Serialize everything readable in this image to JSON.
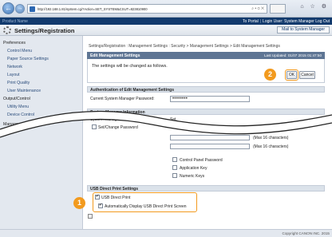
{
  "browser": {
    "url": "http://192.168.1.81/system.cgi?Action=SET_SYSTEM&CSUT=823810900",
    "address_tools": "⌕ • ⊙ ✕",
    "window_controls": "⌂ ☆ ⚙"
  },
  "topbar": {
    "left": "Product Name",
    "portal_link": "To Portal",
    "login_user": "Login User: System Manager",
    "logout": "Log Out"
  },
  "header": {
    "title": "Settings/Registration",
    "mail_button": "Mail to System Manager"
  },
  "sidebar": {
    "sections": [
      {
        "label": "Preferences",
        "items": [
          "Control Menu",
          "Paper Source Settings",
          "Network",
          "Layout",
          "Print Quality",
          "User Maintenance"
        ]
      },
      {
        "label": "Output/Control",
        "items": [
          "Utility Menu",
          "Device Control"
        ]
      },
      {
        "label": "Management Settings",
        "items": []
      }
    ]
  },
  "breadcrumb": "Settings/Registration : Management Settings : Security > Management Settings > Edit Management Settings",
  "panel": {
    "title": "Edit Management Settings",
    "updated": "Last Updated: 01/07 2015 01:47:50",
    "message": "The settings will be changed as follows.",
    "ok_label": "OK",
    "cancel_label": "Cancel"
  },
  "auth_section": {
    "title": "Authentication of Edit Management Settings",
    "field_label": "Current System Manager Password:",
    "field_value": "••••••••"
  },
  "sys_section": {
    "title": "System Manager Information",
    "pw_label": "System Manager Password:",
    "pw_value": "Set.",
    "change_label": "Set/Change Password",
    "hint1": "(Max 16 characters)",
    "hint2": "(Max 16 characters)",
    "options": [
      "Control Panel Password",
      "Application Key",
      "Numeric Keys"
    ]
  },
  "usb_section": {
    "title": "USB Direct Print Settings",
    "usb_label": "USB Direct Print",
    "auto_label": "Automatically Display USB Direct Print Screen"
  },
  "callouts": {
    "one": "1",
    "two": "2"
  },
  "footer": "Copyright CANON INC. 2015"
}
